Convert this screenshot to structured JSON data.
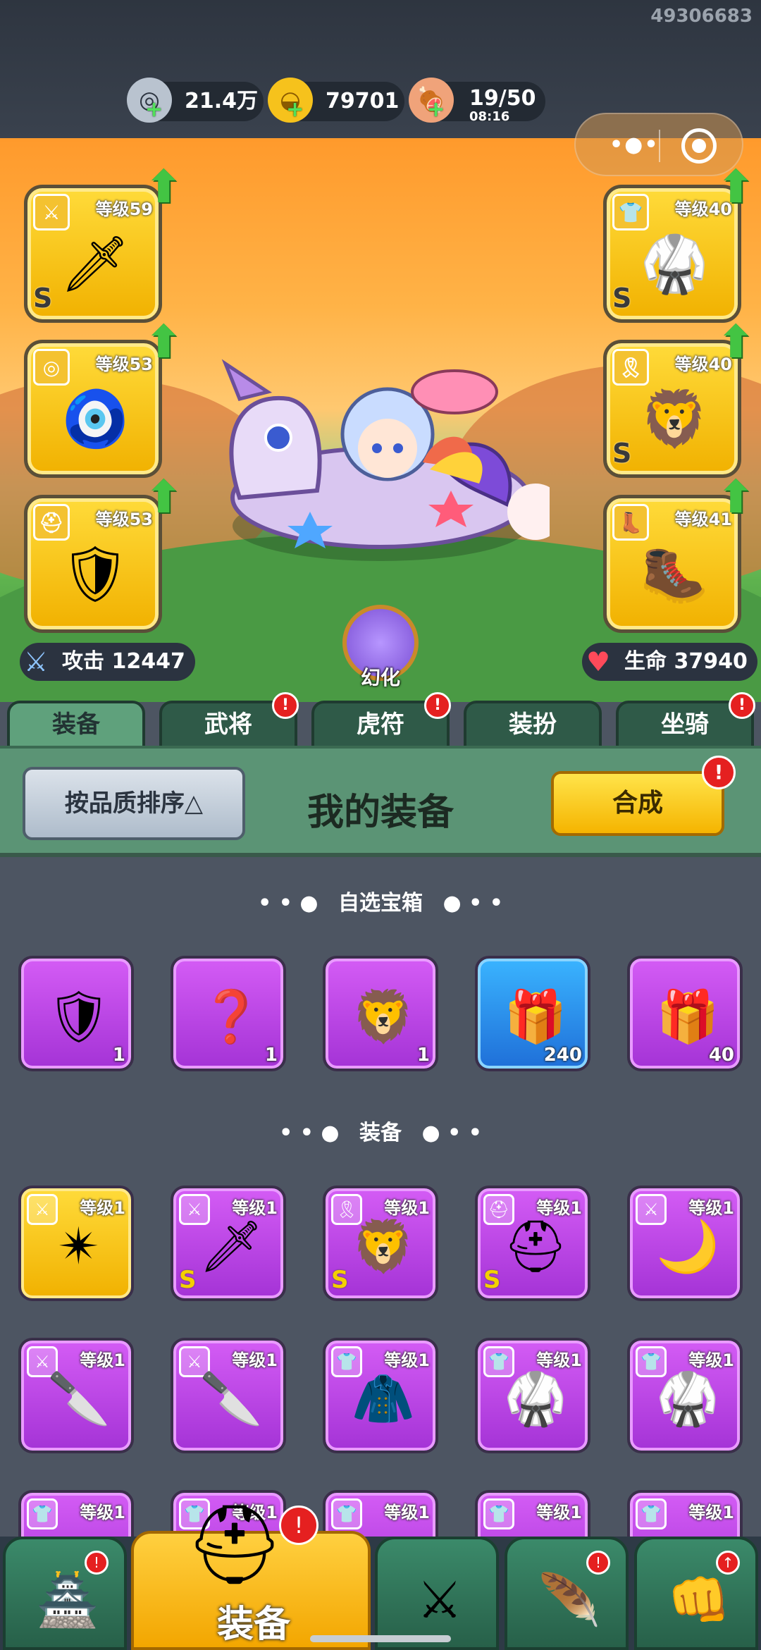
{
  "user_id": "49306683",
  "resources": {
    "silver": {
      "value": "21.4万",
      "icon": "silver-coin-icon"
    },
    "gold": {
      "value": "79701",
      "icon": "gold-ingot-icon"
    },
    "stamina": {
      "value": "19/50",
      "timer": "08:16",
      "icon": "meat-icon"
    }
  },
  "capsule": {
    "menu_glyph": "•●•",
    "close_icon": "target-icon"
  },
  "equip_slots": {
    "left": [
      {
        "type": "weapon",
        "tag": "⚔",
        "level": "等级59",
        "grade": "S",
        "art": "🗡"
      },
      {
        "type": "amulet",
        "tag": "◎",
        "level": "等级53",
        "grade": "",
        "art": "🧿"
      },
      {
        "type": "helmet",
        "tag": "⛑",
        "level": "等级53",
        "grade": "",
        "art": "🛡"
      }
    ],
    "right": [
      {
        "type": "armor",
        "tag": "👕",
        "level": "等级40",
        "grade": "S",
        "art": "🥋"
      },
      {
        "type": "belt",
        "tag": "🎗",
        "level": "等级40",
        "grade": "S",
        "art": "🦁"
      },
      {
        "type": "boots",
        "tag": "👢",
        "level": "等级41",
        "grade": "",
        "art": "🥾"
      }
    ]
  },
  "stats": {
    "attack": {
      "label": "攻击",
      "value": "12447"
    },
    "hp": {
      "label": "生命",
      "value": "37940"
    }
  },
  "transform_label": "幻化",
  "tabs": [
    {
      "label": "装备",
      "active": true,
      "badge": ""
    },
    {
      "label": "武将",
      "active": false,
      "badge": "!"
    },
    {
      "label": "虎符",
      "active": false,
      "badge": "!"
    },
    {
      "label": "装扮",
      "active": false,
      "badge": ""
    },
    {
      "label": "坐骑",
      "active": false,
      "badge": "!"
    }
  ],
  "panel": {
    "sort_label": "按品质排序△",
    "title": "我的装备",
    "merge_label": "合成",
    "merge_badge": "!"
  },
  "section_chests": {
    "title": "自选宝箱"
  },
  "chests": [
    {
      "color": "purple",
      "art": "🛡",
      "count": "1"
    },
    {
      "color": "purple",
      "art": "❓",
      "count": "1"
    },
    {
      "color": "purple",
      "art": "🦁",
      "count": "1"
    },
    {
      "color": "blue",
      "art": "🎁",
      "count": "240"
    },
    {
      "color": "purple",
      "art": "🎁",
      "count": "40"
    }
  ],
  "section_equip": {
    "title": "装备"
  },
  "equipment_row1": [
    {
      "color": "gold",
      "tag": "⚔",
      "level": "等级1",
      "grade": "",
      "art": "✴"
    },
    {
      "color": "purple",
      "tag": "⚔",
      "level": "等级1",
      "grade": "S",
      "art": "🗡"
    },
    {
      "color": "purple",
      "tag": "🎗",
      "level": "等级1",
      "grade": "S",
      "art": "🦁"
    },
    {
      "color": "purple",
      "tag": "⛑",
      "level": "等级1",
      "grade": "S",
      "art": "⛑"
    },
    {
      "color": "purple",
      "tag": "⚔",
      "level": "等级1",
      "grade": "",
      "art": "🌙"
    }
  ],
  "equipment_row2": [
    {
      "color": "purple",
      "tag": "⚔",
      "level": "等级1",
      "grade": "",
      "art": "🔪"
    },
    {
      "color": "purple",
      "tag": "⚔",
      "level": "等级1",
      "grade": "",
      "art": "🔪"
    },
    {
      "color": "purple",
      "tag": "👕",
      "level": "等级1",
      "grade": "",
      "art": "🧥"
    },
    {
      "color": "purple",
      "tag": "👕",
      "level": "等级1",
      "grade": "",
      "art": "🥋"
    },
    {
      "color": "purple",
      "tag": "👕",
      "level": "等级1",
      "grade": "",
      "art": "🥋"
    }
  ],
  "equipment_row3": [
    {
      "color": "purple",
      "tag": "👕",
      "level": "等级1"
    },
    {
      "color": "purple",
      "tag": "👕",
      "level": "等级1"
    },
    {
      "color": "purple",
      "tag": "👕",
      "level": "等级1"
    },
    {
      "color": "purple",
      "tag": "👕",
      "level": "等级1"
    },
    {
      "color": "purple",
      "tag": "👕",
      "level": "等级1"
    }
  ],
  "bottom_nav": [
    {
      "name": "main-city",
      "art": "🏯",
      "badge": "!"
    },
    {
      "name": "equipment",
      "label": "装备",
      "art": "⛑",
      "badge": "!",
      "active": true
    },
    {
      "name": "battle",
      "art": "⚔",
      "badge": ""
    },
    {
      "name": "heroes",
      "art": "🪶",
      "badge": "!"
    },
    {
      "name": "upgrade",
      "art": "👊",
      "badge": "↑"
    }
  ],
  "colors": {
    "accent_gold": "#f5b400",
    "tab_green": "#5fa17c",
    "badge_red": "#e52020",
    "rare_purple": "#a433d6"
  }
}
